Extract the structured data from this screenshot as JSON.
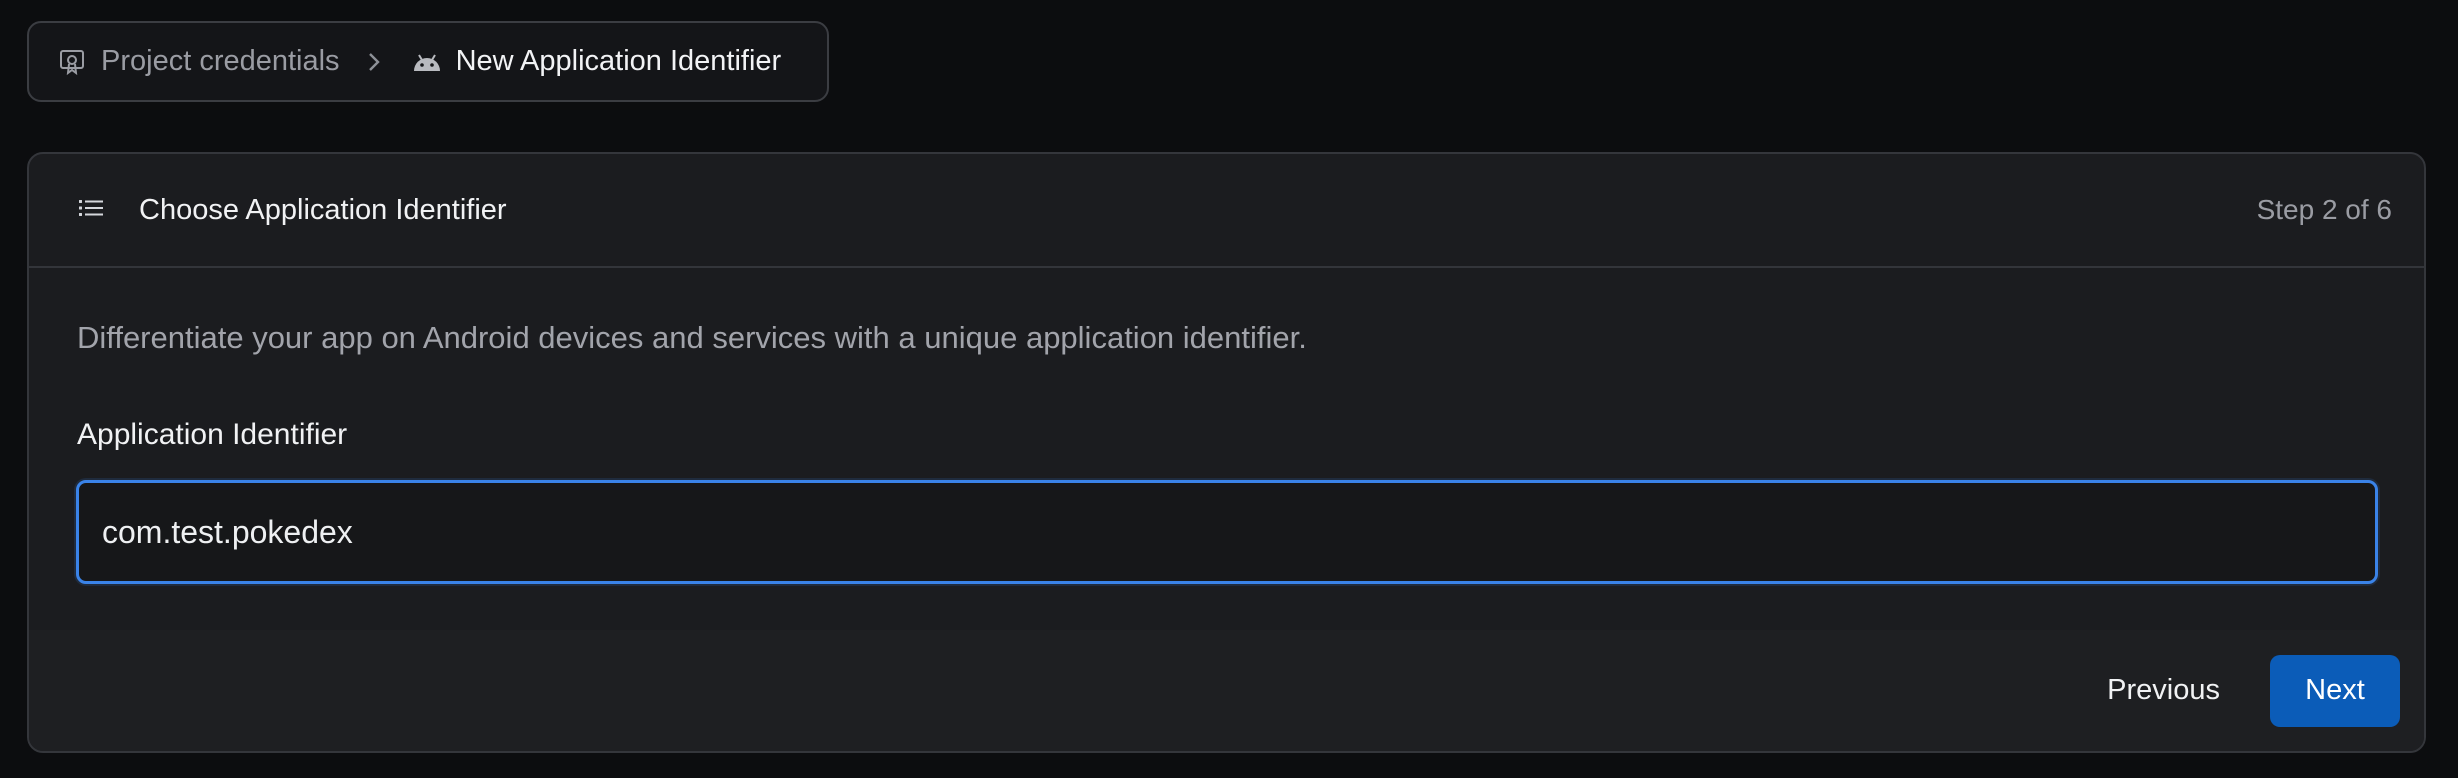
{
  "breadcrumb": {
    "items": [
      {
        "label": "Project credentials",
        "icon": "certificate-icon"
      },
      {
        "label": "New Application Identifier",
        "icon": "android-icon"
      }
    ],
    "separator_icon": "chevron-right-icon"
  },
  "step": {
    "title": "Choose Application Identifier",
    "icon": "list-icon",
    "progress_label": "Step 2 of 6",
    "description": "Differentiate your app on Android devices and services with a unique application identifier."
  },
  "form": {
    "identifier_label": "Application Identifier",
    "identifier_value": "com.test.pokedex"
  },
  "footer": {
    "previous_label": "Previous",
    "next_label": "Next"
  },
  "colors": {
    "accent": "#0b5cb8",
    "focus_ring": "#3a83e8",
    "background": "#0c0d0f"
  }
}
